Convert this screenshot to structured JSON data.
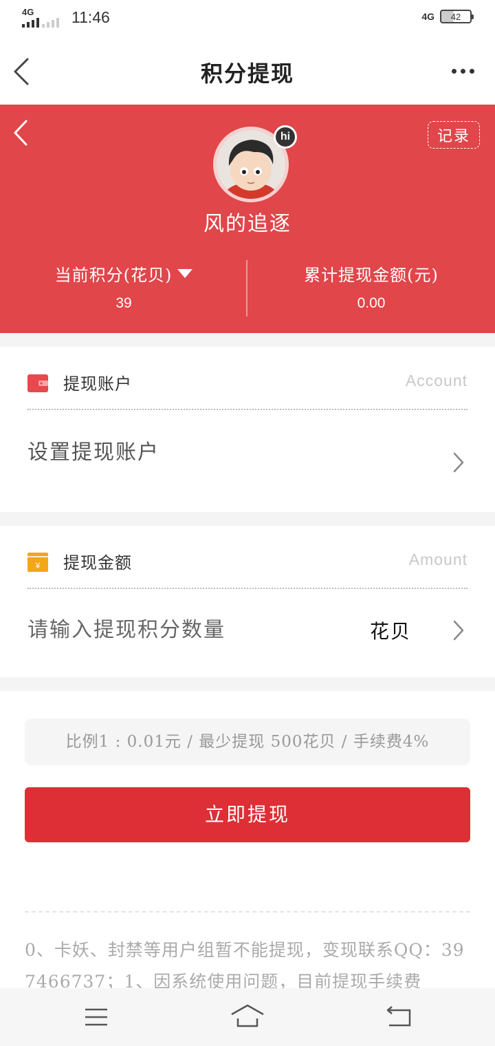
{
  "status_bar": {
    "network_left": "4G",
    "time": "11:46",
    "network_right": "4G",
    "battery": "42"
  },
  "nav": {
    "title": "积分提现"
  },
  "header": {
    "record_label": "记录",
    "avatar_badge": "hi",
    "username": "风的追逐",
    "stats": [
      {
        "label": "当前积分(花贝)",
        "value": "39"
      },
      {
        "label": "累计提现金额(元)",
        "value": "0.00"
      }
    ]
  },
  "account_card": {
    "title": "提现账户",
    "en_title": "Account",
    "row_text": "设置提现账户",
    "icon_color": "#e9484c"
  },
  "amount_card": {
    "title": "提现金额",
    "en_title": "Amount",
    "placeholder": "请输入提现积分数量",
    "unit": "花贝",
    "icon_color": "#f2a618",
    "icon_symbol": "¥"
  },
  "ratio_text": "比例1 : 0.01元 / 最少提现 500花贝 / 手续费4%",
  "submit_label": "立即提现",
  "notice_text": "0、卡妖、封禁等用户组暂不能提现，变现联系QQ：397466737；1、因系统使用问题，目前提现手续费",
  "colors": {
    "header_red": "#e0464a",
    "button_red": "#dd2f35"
  },
  "bottom_nav": {
    "icons": [
      "menu-icon",
      "home-icon",
      "back-icon"
    ]
  }
}
